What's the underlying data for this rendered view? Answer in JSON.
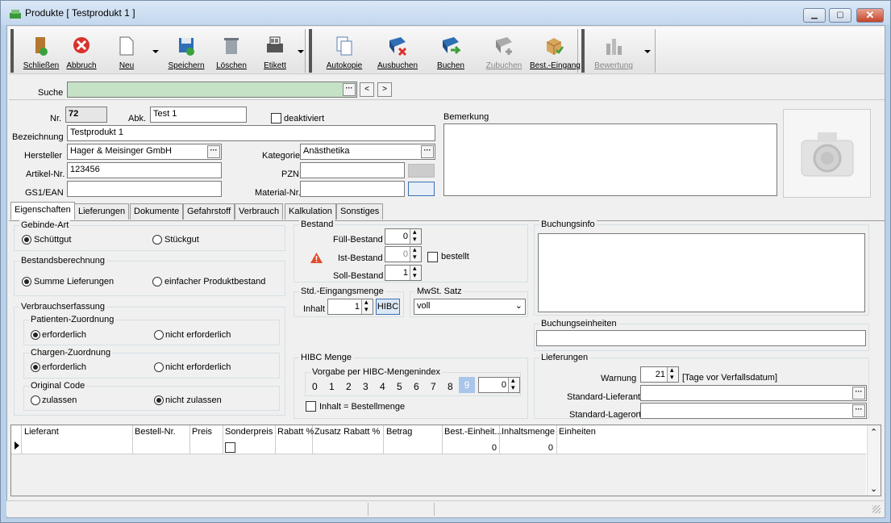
{
  "window": {
    "title": "Produkte [ Testprodukt 1 ]",
    "min": "▁",
    "max": "▢",
    "close": "✕"
  },
  "toolbar": {
    "close": "Schließen",
    "cancel": "Abbruch",
    "new": "Neu",
    "save": "Speichern",
    "delete": "Löschen",
    "label": "Etikett",
    "autocopy": "Autokopie",
    "book_out": "Ausbuchen",
    "book": "Buchen",
    "book_in": "Zubuchen",
    "order_receipt": "Best.-Eingang",
    "rating": "Bewertung"
  },
  "search": {
    "label": "Suche",
    "dots": "···",
    "prev": "<",
    "next": ">"
  },
  "product": {
    "nr_label": "Nr.",
    "nr_value": "72",
    "abk_label": "Abk.",
    "abk_value": "Test 1",
    "deactivated_label": "deaktiviert",
    "designation_label": "Bezeichnung",
    "designation_value": "Testprodukt 1",
    "manufacturer_label": "Hersteller",
    "manufacturer_value": "Hager & Meisinger GmbH",
    "category_label": "Kategorie",
    "category_value": "Anästhetika",
    "article_label": "Artikel-Nr.",
    "article_value": "123456",
    "pzn_label": "PZN",
    "gs1_label": "GS1/EAN",
    "material_label": "Material-Nr.",
    "remark_label": "Bemerkung"
  },
  "tabs": [
    "Eigenschaften",
    "Lieferungen",
    "Dokumente",
    "Gefahrstoff",
    "Verbrauch",
    "Kalkulation",
    "Sonstiges"
  ],
  "container": {
    "title": "Gebinde-Art",
    "bulk": "Schüttgut",
    "piece": "Stückgut"
  },
  "stock_calc": {
    "title": "Bestandsberechnung",
    "sum": "Summe Lieferungen",
    "simple": "einfacher Produktbestand"
  },
  "consumption": {
    "title": "Verbrauchserfassung",
    "patient": {
      "title": "Patienten-Zuordnung",
      "required": "erforderlich",
      "not_required": "nicht erforderlich"
    },
    "batch": {
      "title": "Chargen-Zuordnung",
      "required": "erforderlich",
      "not_required": "nicht erforderlich"
    },
    "code": {
      "title": "Original Code",
      "allow": "zulassen",
      "disallow": "nicht zulassen"
    }
  },
  "stock": {
    "title": "Bestand",
    "fill_label": "Füll-Bestand",
    "fill_value": "0",
    "actual_label": "Ist-Bestand",
    "actual_value": "0",
    "target_label": "Soll-Bestand",
    "target_value": "1",
    "ordered_label": "bestellt"
  },
  "std_in": {
    "title": "Std.-Eingangsmenge",
    "content_label": "Inhalt",
    "content_value": "1",
    "hibc_btn": "HIBC"
  },
  "vat": {
    "title": "MwSt. Satz",
    "value": "voll"
  },
  "hibc": {
    "title": "HIBC Menge",
    "sub": "Vorgabe per HIBC-Mengenindex",
    "nums": [
      "0",
      "1",
      "2",
      "3",
      "4",
      "5",
      "6",
      "7",
      "8",
      "9"
    ],
    "spin_value": "0",
    "content_eq": "Inhalt = Bestellmenge"
  },
  "booking_info": {
    "title": "Buchungsinfo"
  },
  "booking_units": {
    "title": "Buchungseinheiten"
  },
  "deliveries": {
    "title": "Lieferungen",
    "warning_label": "Warnung",
    "warning_value": "21",
    "warning_unit": "[Tage vor Verfallsdatum]",
    "supplier_label": "Standard-Lieferant",
    "storage_label": "Standard-Lagerort"
  },
  "grid": {
    "headers": [
      "Lieferant",
      "Bestell-Nr.",
      "Preis",
      "Sonderpreis",
      "Rabatt %",
      "Zusatz Rabatt %",
      "Betrag",
      "Best.-Einheit...",
      "Inhaltsmenge",
      "Einheiten"
    ],
    "row": {
      "best_unit": "0",
      "content_qty": "0"
    }
  }
}
